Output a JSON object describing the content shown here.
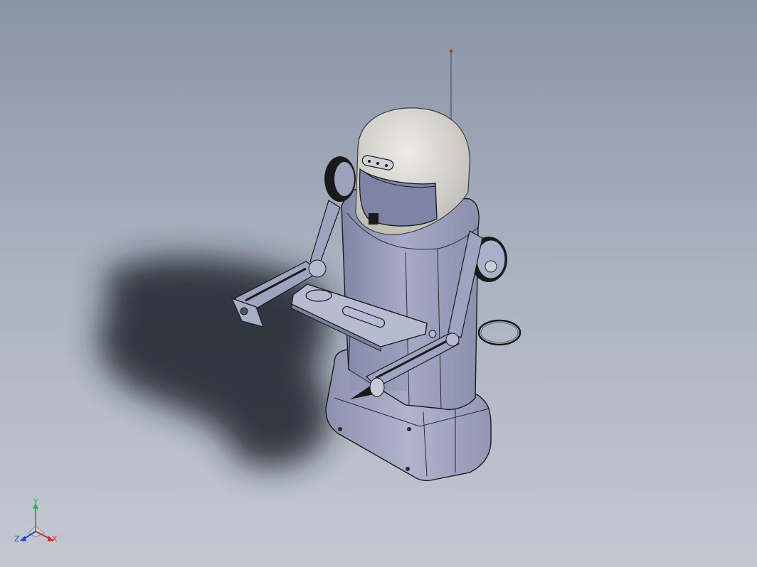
{
  "viewport": {
    "background_top": "#8894a8",
    "background_bottom": "#c3c8d1",
    "model": {
      "body_color": "#9ea3c0",
      "helmet_color": "#d8d6cf",
      "edge_color": "#1a1a1a",
      "shadow_color": "#1e2129",
      "antenna_tip_color": "#c0392b",
      "ring_color": "#1a1a1a"
    }
  },
  "triad": {
    "x_label": "X",
    "y_label": "Y",
    "z_label": "Z",
    "x_color": "#d22b2b",
    "y_color": "#2bb14a",
    "z_color": "#2b46c8"
  }
}
